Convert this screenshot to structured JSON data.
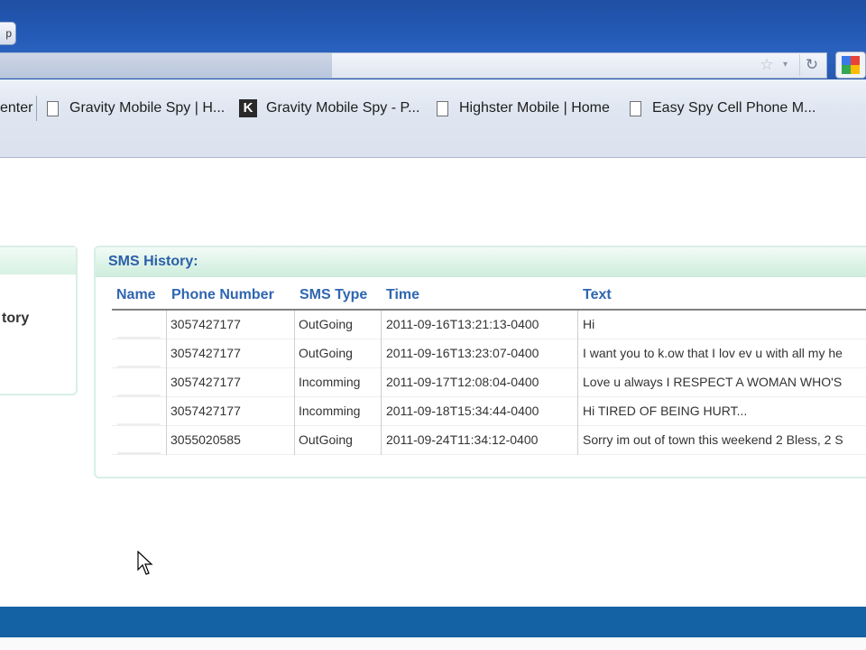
{
  "browser": {
    "tab_label": "p",
    "bookmarks": [
      {
        "label": "enter",
        "icon": "none"
      },
      {
        "label": "Gravity Mobile Spy | H...",
        "icon": "page-icon"
      },
      {
        "label": "Gravity Mobile Spy - P...",
        "icon": "k-icon"
      },
      {
        "label": "Highster Mobile | Home",
        "icon": "page-icon"
      },
      {
        "label": "Easy Spy Cell Phone M...",
        "icon": "page-icon"
      }
    ],
    "k_glyph": "K"
  },
  "left_panel": {
    "label": "tory"
  },
  "sms": {
    "title": "SMS History:",
    "columns": [
      "Name",
      "Phone Number",
      "SMS Type",
      "Time",
      "Text"
    ],
    "rows": [
      {
        "name": "",
        "phone": "3057427177",
        "type": "OutGoing",
        "time": "2011-09-16T13:21:13-0400",
        "text": "Hi"
      },
      {
        "name": "",
        "phone": "3057427177",
        "type": "OutGoing",
        "time": "2011-09-16T13:23:07-0400",
        "text": "I want you to k.ow that I lov ev u with all my he"
      },
      {
        "name": "",
        "phone": "3057427177",
        "type": "Incomming",
        "time": "2011-09-17T12:08:04-0400",
        "text": "Love u always I RESPECT A WOMAN WHO'S"
      },
      {
        "name": "",
        "phone": "3057427177",
        "type": "Incomming",
        "time": "2011-09-18T15:34:44-0400",
        "text": "Hi TIRED OF BEING HURT..."
      },
      {
        "name": "",
        "phone": "3055020585",
        "type": "OutGoing",
        "time": "2011-09-24T11:34:12-0400",
        "text": "Sorry im out of town this weekend 2 Bless, 2 S"
      }
    ]
  },
  "colors": {
    "header_blue": "#2359b5",
    "table_header_text": "#2f66b0",
    "panel_border": "#d7efe5",
    "footer_bar": "#1462a3"
  }
}
